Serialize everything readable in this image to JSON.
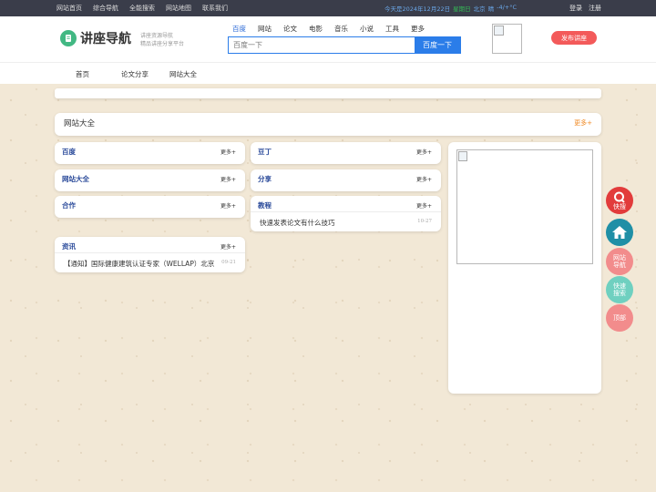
{
  "topbar": {
    "nav": [
      "网站首页",
      "综合导航",
      "全能搜索",
      "网站地图",
      "联系我们"
    ],
    "date_text": "今天是2024年12月22日",
    "weekday": "星期日",
    "city": "北京",
    "weather": "晴",
    "temp": "-4/+°C",
    "login": "登录",
    "register": "注册"
  },
  "header": {
    "logo_text": "讲座导航",
    "logo_sub1": "讲座资源导航",
    "logo_sub2": "精品讲座分享平台",
    "search_tabs": [
      "百度",
      "网站",
      "论文",
      "电影",
      "音乐",
      "小说",
      "工具",
      "更多"
    ],
    "active_tab": 0,
    "search_placeholder": "百度一下",
    "search_button": "百度一下",
    "publish_button": "发布讲座"
  },
  "mainnav": [
    "首页",
    "论文分享",
    "网站大全"
  ],
  "section": {
    "title": "网站大全",
    "more": "更多+"
  },
  "boxes": {
    "baidu": {
      "title": "百度",
      "more": "更多+"
    },
    "wangzhan": {
      "title": "网站大全",
      "more": "更多+"
    },
    "hezuo": {
      "title": "合作",
      "more": "更多+"
    },
    "zixun": {
      "title": "资讯",
      "more": "更多+",
      "items": [
        {
          "text": "【通知】国际健康建筑认证专家（WELLAP）北京",
          "date": "09-21"
        }
      ]
    },
    "ding": {
      "title": "豆丁",
      "more": "更多+"
    },
    "fenxiang": {
      "title": "分享",
      "more": "更多+"
    },
    "jiaocheng": {
      "title": "教程",
      "more": "更多+",
      "items": [
        {
          "text": "快速发表论文有什么技巧",
          "date": "10-27"
        }
      ]
    }
  },
  "floats": {
    "kuaisou": "快搜",
    "wangzhan_line1": "网站",
    "wangzhan_line2": "导航",
    "kuaisu_line1": "快速",
    "kuaisu_line2": "搜索",
    "top": "顶部"
  },
  "colors": {
    "topbar_bg": "#3a3d4a",
    "accent_blue": "#2b7de9",
    "publish_red": "#f35a5a",
    "more_orange": "#f08a24",
    "box_title_blue": "#2a4a9a",
    "float_red": "#e23b3b",
    "float_teal": "#1f8fa6",
    "float_pink": "#f28c8c",
    "float_mint": "#6fd0c0"
  }
}
